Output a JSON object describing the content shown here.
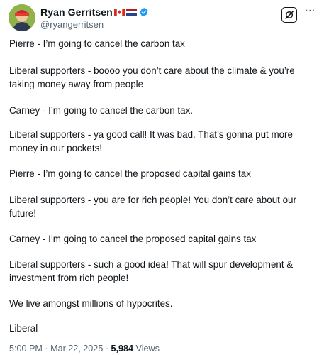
{
  "author": {
    "display_name": "Ryan Gerritsen",
    "handle": "@ryangerritsen",
    "flags": [
      "canada-flag",
      "netherlands-flag"
    ],
    "verified": true
  },
  "header_actions": {
    "grok_icon": "grok-icon",
    "more_icon": "more-icon",
    "more_label": "···"
  },
  "tweet": {
    "paragraphs": [
      "Pierre - I’m going to cancel the carbon tax",
      "Liberal supporters - boooo you don’t care about the climate & you’re taking money away from people",
      "Carney - I’m going to cancel the carbon tax.",
      "Liberal supporters - ya good call! It was bad. That’s gonna put more money in our pockets!",
      "Pierre - I’m going to cancel the proposed capital gains tax",
      "Liberal supporters - you are for rich people! You don’t care about our future!",
      "Carney - I’m going to cancel the proposed capital gains tax",
      "Liberal supporters - such a good idea! That will spur development & investment from rich people!",
      "We live amongst millions of hypocrites.",
      "Liberal"
    ]
  },
  "meta": {
    "time": "5:00 PM",
    "separator": "·",
    "date": "Mar 22, 2025",
    "views_count": "5,984",
    "views_label": "Views"
  },
  "colors": {
    "text_primary": "#0f1419",
    "text_secondary": "#536471",
    "verified_blue": "#1d9bf0"
  }
}
